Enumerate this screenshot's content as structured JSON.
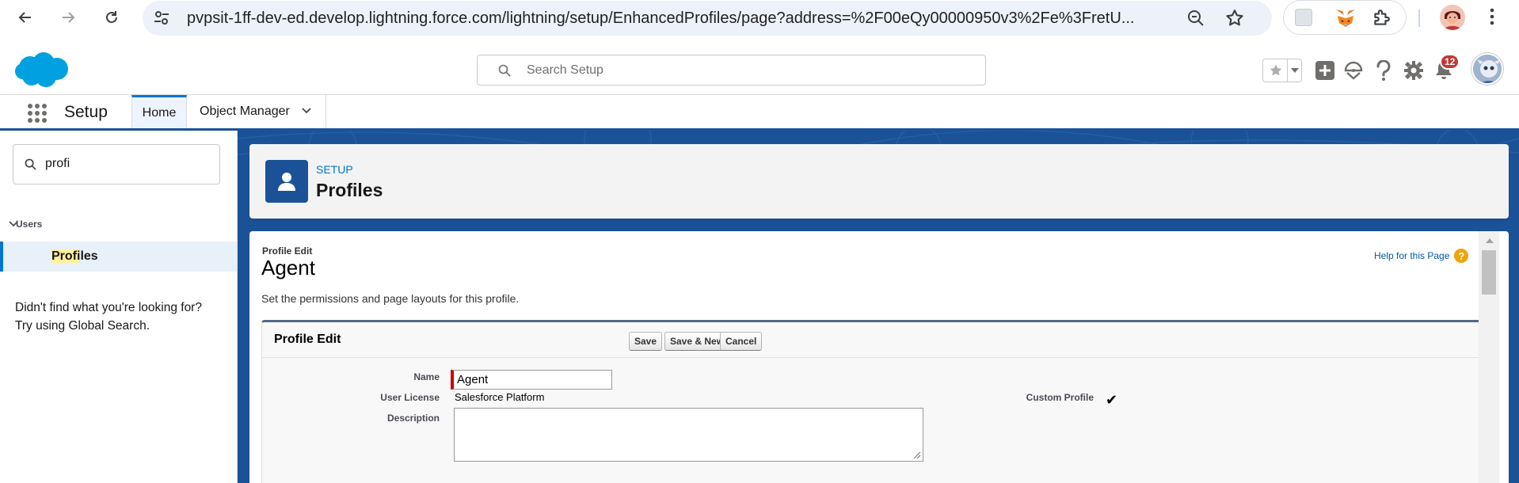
{
  "browser": {
    "url": "pvpsit-1ff-dev-ed.develop.lightning.force.com/lightning/setup/EnhancedProfiles/page?address=%2F00eQy00000950v3%2Fe%3FretU..."
  },
  "header": {
    "search_placeholder": "Search Setup",
    "notification_count": "12"
  },
  "appnav": {
    "app_name": "Setup",
    "tabs": [
      {
        "label": "Home"
      },
      {
        "label": "Object Manager"
      }
    ]
  },
  "sidebar": {
    "quickfind_value": "profi",
    "tree_parent": "Users",
    "tree_child_highlight": "Profi",
    "tree_child_rest": "les",
    "not_found_line1": "Didn't find what you're looking for?",
    "not_found_line2": "Try using Global Search."
  },
  "page_header": {
    "eyebrow": "SETUP",
    "title": "Profiles"
  },
  "content": {
    "breadcrumb": "Profile Edit",
    "title": "Agent",
    "help_link": "Help for this Page",
    "help_icon": "?",
    "description": "Set the permissions and page layouts for this profile.",
    "section_title": "Profile Edit",
    "buttons": {
      "save": "Save",
      "save_new": "Save & New",
      "cancel": "Cancel"
    },
    "fields": {
      "name_label": "Name",
      "name_value": "Agent",
      "license_label": "User License",
      "license_value": "Salesforce Platform",
      "custom_label": "Custom Profile",
      "custom_value": "✔",
      "description_label": "Description"
    }
  },
  "colors": {
    "brand_blue": "#1b5297",
    "link_blue": "#0176d3",
    "required_red": "#cc0000",
    "badge_red": "#c23934"
  }
}
